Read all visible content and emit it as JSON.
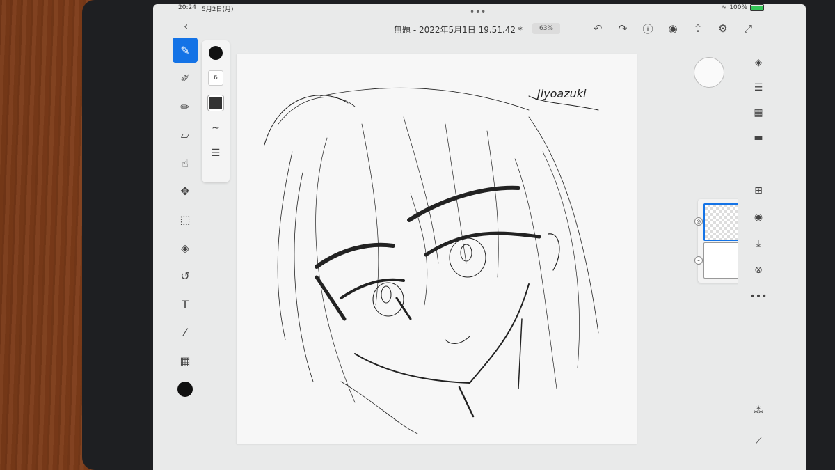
{
  "status": {
    "time": "20:24",
    "date": "5月2日(月)",
    "battery": "100%"
  },
  "topbar": {
    "back_icon": "chevron-left",
    "title": "無題 - 2022年5月1日 19.51.42 *",
    "dropdown_icon": "chevron-down",
    "zoom": "63%"
  },
  "toolbar_icons": [
    "undo-icon",
    "redo-icon",
    "help-icon",
    "share-user-icon",
    "export-icon",
    "settings-icon",
    "fullscreen-icon"
  ],
  "left_tools": [
    "pixel-brush-icon",
    "live-brush-icon",
    "vector-brush-icon",
    "eraser-icon",
    "smudge-icon",
    "transform-icon",
    "selection-icon",
    "fill-icon",
    "liquify-icon",
    "text-tool-icon",
    "eyedropper-icon",
    "image-icon"
  ],
  "text_tool_glyph": "T",
  "brush_panel": {
    "size": "6"
  },
  "signature": "Jiyoazuki",
  "right_tools": [
    "layers-icon",
    "adjustments-icon",
    "grid-icon",
    "comment-icon",
    "add-layer-icon",
    "visibility-icon",
    "merge-icon",
    "blend-icon",
    "more-icon",
    "actions-icon",
    "ruler-icon"
  ],
  "colors": {
    "accent": "#1473e6",
    "ink": "#111111",
    "paper": "#f7f7f7"
  }
}
